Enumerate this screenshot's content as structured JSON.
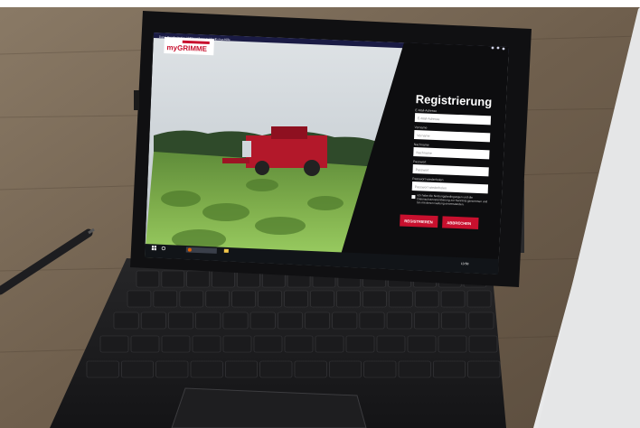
{
  "menu_bar": {
    "items": [
      "Datei",
      "Bearbeiten",
      "Ansicht",
      "Chronik",
      "Lesezeichen",
      "Extras",
      "Hilfe"
    ]
  },
  "logo": {
    "prefix": "my",
    "brand": "GRIMME"
  },
  "register_panel": {
    "title": "Registrierung",
    "fields": [
      {
        "label": "E-Mail-Adresse",
        "placeholder": "E-Mail-Adresse"
      },
      {
        "label": "Vorname",
        "placeholder": "Vorname"
      },
      {
        "label": "Nachname",
        "placeholder": "Nachname"
      },
      {
        "label": "Passwort",
        "placeholder": "Passwort"
      },
      {
        "label": "Passwort wiederholen",
        "placeholder": "Passwort wiederholen"
      }
    ],
    "consent_text": "Ich habe die Nutzungsbedingungen und die Datenschutzvereinbarung zur Kenntnis genommen und bin mit deren Geltung einverstanden.",
    "register_button": "REGISTRIEREN",
    "cancel_button": "ABBRECHEN"
  },
  "taskbar": {
    "search_placeholder": "Frage mich etwas",
    "clock": "13:58"
  },
  "colors": {
    "brand_red": "#c8102e",
    "panel_bg": "#0d0d0f",
    "gray_card": "#e8e9ea"
  },
  "icons": [
    "windows-start-icon",
    "search-icon",
    "browser-icon",
    "folder-icon",
    "checkbox-icon",
    "stylus-pen-icon"
  ]
}
